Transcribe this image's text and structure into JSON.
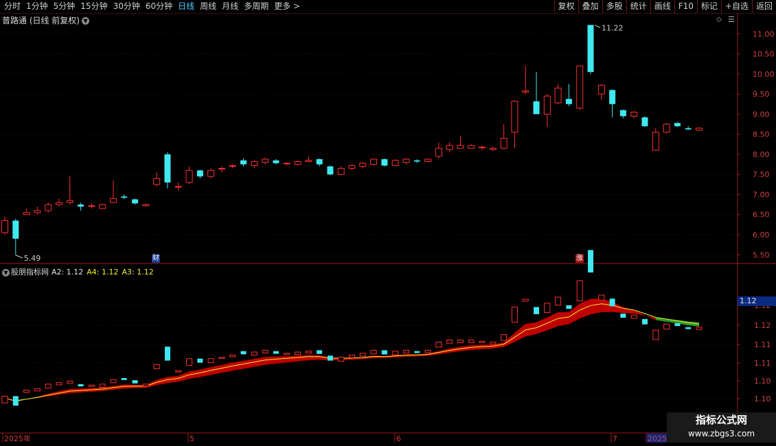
{
  "toolbar": {
    "left_items": [
      "分时",
      "1分钟",
      "5分钟",
      "15分钟",
      "30分钟",
      "60分钟",
      "日线",
      "周线",
      "月线",
      "多周期",
      "更多 >"
    ],
    "active_item": "日线",
    "right_items": [
      "复权",
      "叠加",
      "多股",
      "统计",
      "画线",
      "F10",
      "标记",
      "+自选",
      "返回"
    ]
  },
  "main_panel": {
    "title": "普路通 (日线 前复权)",
    "high_label": "11.22",
    "low_label": "5.49",
    "marker_finance": "财",
    "marker_up": "涨",
    "price_axis": [
      "11.00",
      "10.50",
      "10.00",
      "9.50",
      "9.00",
      "8.50",
      "8.00",
      "7.50",
      "7.00",
      "6.50",
      "6.00",
      "5.50"
    ]
  },
  "indicator_panel": {
    "name": "股朋指标网",
    "a2_label": "A2:",
    "a2_value": "1.12",
    "a4_label": "A4:",
    "a4_value": "1.12",
    "a3_label": "A3:",
    "a3_value": "1.12",
    "current_tag": "1.12",
    "axis": [
      "1.12",
      "1.12",
      "1.11",
      "1.11",
      "1.10",
      "1.10"
    ]
  },
  "time_axis": {
    "labels": [
      "2025年",
      "5",
      "6",
      "7",
      "2025/"
    ]
  },
  "watermark": {
    "line1": "指标公式网",
    "line2": "www.zbgs3.com"
  },
  "colors": {
    "up": "#ff3030",
    "down": "#40e8f0",
    "band_up": "#c00000",
    "band_down": "#2a9a2a",
    "line_yellow": "#f0f030",
    "grid": "#4a0a0a"
  },
  "chart_data": {
    "type": "candlestick",
    "price_ylim": [
      5.3,
      11.5
    ],
    "candles": [
      [
        6.05,
        6.35,
        6.45,
        6.0
      ],
      [
        6.35,
        5.9,
        6.4,
        5.49
      ],
      [
        6.5,
        6.55,
        6.65,
        6.5
      ],
      [
        6.55,
        6.6,
        6.7,
        6.5
      ],
      [
        6.6,
        6.75,
        6.8,
        6.55
      ],
      [
        6.75,
        6.8,
        6.9,
        6.7
      ],
      [
        6.8,
        6.85,
        7.45,
        6.75
      ],
      [
        6.75,
        6.7,
        6.8,
        6.6
      ],
      [
        6.72,
        6.72,
        6.78,
        6.65
      ],
      [
        6.65,
        6.75,
        6.78,
        6.65
      ],
      [
        6.8,
        6.9,
        7.35,
        6.8
      ],
      [
        6.95,
        6.92,
        7.0,
        6.88
      ],
      [
        6.88,
        6.78,
        6.9,
        6.75
      ],
      [
        6.72,
        6.75,
        6.78,
        6.7
      ],
      [
        7.25,
        7.4,
        7.55,
        7.2
      ],
      [
        8.0,
        7.3,
        8.05,
        7.15
      ],
      [
        7.2,
        7.2,
        7.3,
        7.1
      ],
      [
        7.3,
        7.6,
        7.7,
        7.25
      ],
      [
        7.6,
        7.45,
        7.62,
        7.4
      ],
      [
        7.45,
        7.6,
        7.65,
        7.4
      ],
      [
        7.65,
        7.65,
        7.7,
        7.55
      ],
      [
        7.7,
        7.72,
        7.75,
        7.65
      ],
      [
        7.85,
        7.75,
        7.9,
        7.7
      ],
      [
        7.72,
        7.82,
        7.85,
        7.65
      ],
      [
        7.8,
        7.88,
        7.92,
        7.75
      ],
      [
        7.85,
        7.78,
        7.88,
        7.75
      ],
      [
        7.78,
        7.78,
        7.8,
        7.72
      ],
      [
        7.75,
        7.82,
        7.85,
        7.72
      ],
      [
        7.82,
        7.85,
        7.95,
        7.8
      ],
      [
        7.88,
        7.75,
        7.9,
        7.7
      ],
      [
        7.7,
        7.5,
        7.72,
        7.48
      ],
      [
        7.5,
        7.65,
        7.7,
        7.48
      ],
      [
        7.65,
        7.72,
        7.75,
        7.6
      ],
      [
        7.7,
        7.78,
        7.8,
        7.65
      ],
      [
        7.75,
        7.88,
        7.9,
        7.72
      ],
      [
        7.88,
        7.72,
        7.9,
        7.7
      ],
      [
        7.72,
        7.85,
        7.88,
        7.7
      ],
      [
        7.8,
        7.88,
        7.9,
        7.75
      ],
      [
        7.85,
        7.82,
        7.88,
        7.78
      ],
      [
        7.82,
        7.88,
        7.9,
        7.8
      ],
      [
        7.95,
        8.15,
        8.3,
        7.9
      ],
      [
        8.12,
        8.22,
        8.3,
        8.05
      ],
      [
        8.15,
        8.22,
        8.45,
        8.15
      ],
      [
        8.15,
        8.22,
        8.25,
        8.15
      ],
      [
        8.18,
        8.18,
        8.22,
        8.1
      ],
      [
        8.12,
        8.15,
        8.2,
        8.08
      ],
      [
        8.15,
        8.4,
        8.75,
        8.12
      ],
      [
        8.55,
        9.32,
        9.35,
        8.15
      ],
      [
        9.55,
        9.58,
        10.2,
        9.5
      ],
      [
        9.32,
        9.0,
        10.05,
        9.0
      ],
      [
        9.0,
        9.45,
        9.5,
        8.68
      ],
      [
        9.28,
        9.65,
        9.75,
        9.25
      ],
      [
        9.38,
        9.25,
        9.75,
        9.2
      ],
      [
        9.15,
        10.2,
        10.2,
        9.1
      ],
      [
        11.22,
        10.05,
        11.22,
        10.0
      ],
      [
        9.5,
        9.72,
        9.75,
        9.35
      ],
      [
        9.6,
        9.25,
        9.62,
        8.92
      ],
      [
        9.1,
        8.95,
        9.12,
        8.9
      ],
      [
        8.95,
        9.05,
        9.08,
        8.9
      ],
      [
        8.92,
        8.7,
        8.95,
        8.68
      ],
      [
        8.1,
        8.55,
        8.65,
        8.1
      ],
      [
        8.55,
        8.75,
        8.78,
        8.52
      ],
      [
        8.78,
        8.7,
        8.8,
        8.68
      ],
      [
        8.65,
        8.62,
        8.7,
        8.6
      ],
      [
        8.6,
        8.65,
        8.68,
        8.58
      ]
    ],
    "indicator_ylim": [
      1.095,
      1.125
    ],
    "series": [
      {
        "name": "A2",
        "last": 1.12
      },
      {
        "name": "A4",
        "last": 1.12
      },
      {
        "name": "A3",
        "last": 1.12
      }
    ]
  }
}
